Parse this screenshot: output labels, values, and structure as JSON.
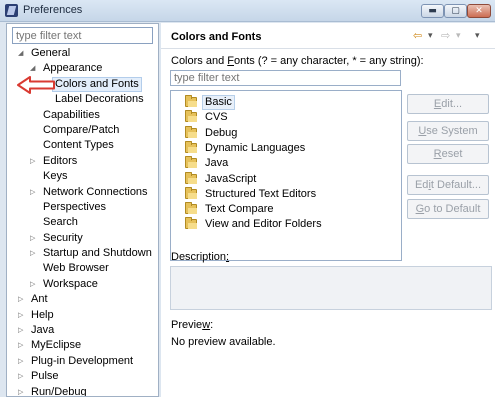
{
  "window": {
    "title": "Preferences",
    "controls": {
      "minimize": "▬",
      "maximize": "▢",
      "close": "✕"
    }
  },
  "left": {
    "filter_placeholder": "type filter text",
    "tree": [
      {
        "label": "General",
        "arrow": "◢",
        "level": 0,
        "expanded": true
      },
      {
        "label": "Appearance",
        "arrow": "◢",
        "level": 1,
        "expanded": true
      },
      {
        "label": "Colors and Fonts",
        "arrow": "",
        "level": 2,
        "selected": true
      },
      {
        "label": "Label Decorations",
        "arrow": "",
        "level": 2
      },
      {
        "label": "Capabilities",
        "arrow": "",
        "level": 1
      },
      {
        "label": "Compare/Patch",
        "arrow": "",
        "level": 1
      },
      {
        "label": "Content Types",
        "arrow": "",
        "level": 1
      },
      {
        "label": "Editors",
        "arrow": "▷",
        "level": 1
      },
      {
        "label": "Keys",
        "arrow": "",
        "level": 1
      },
      {
        "label": "Network Connections",
        "arrow": "▷",
        "level": 1
      },
      {
        "label": "Perspectives",
        "arrow": "",
        "level": 1
      },
      {
        "label": "Search",
        "arrow": "",
        "level": 1
      },
      {
        "label": "Security",
        "arrow": "▷",
        "level": 1
      },
      {
        "label": "Startup and Shutdown",
        "arrow": "▷",
        "level": 1
      },
      {
        "label": "Web Browser",
        "arrow": "",
        "level": 1
      },
      {
        "label": "Workspace",
        "arrow": "▷",
        "level": 1
      },
      {
        "label": "Ant",
        "arrow": "▷",
        "level": 0
      },
      {
        "label": "Help",
        "arrow": "▷",
        "level": 0
      },
      {
        "label": "Java",
        "arrow": "▷",
        "level": 0
      },
      {
        "label": "MyEclipse",
        "arrow": "▷",
        "level": 0
      },
      {
        "label": "Plug-in Development",
        "arrow": "▷",
        "level": 0
      },
      {
        "label": "Pulse",
        "arrow": "▷",
        "level": 0
      },
      {
        "label": "Run/Debug",
        "arrow": "▷",
        "level": 0
      }
    ]
  },
  "right": {
    "title": "Colors and Fonts",
    "nav": {
      "back": "⇦",
      "back_menu": "▾",
      "forward": "⇨",
      "forward_menu": "▾",
      "menu": "▾"
    },
    "colors_fonts_label_pre": "Colors and ",
    "colors_fonts_label_mnemonic": "F",
    "colors_fonts_label_post": "onts (? = any character, * = any string):",
    "font_filter_placeholder": "type filter text",
    "font_categories": [
      {
        "label": "Basic",
        "selected": true
      },
      {
        "label": "CVS"
      },
      {
        "label": "Debug"
      },
      {
        "label": "Dynamic Languages"
      },
      {
        "label": "Java"
      },
      {
        "label": "JavaScript"
      },
      {
        "label": "Structured Text Editors"
      },
      {
        "label": "Text Compare"
      },
      {
        "label": "View and Editor Folders"
      }
    ],
    "buttons": [
      {
        "pre": "",
        "mnemonic": "E",
        "post": "dit...",
        "enabled": false
      },
      {
        "pre": "",
        "mnemonic": "U",
        "post": "se System Font",
        "enabled": false
      },
      {
        "pre": "",
        "mnemonic": "R",
        "post": "eset",
        "enabled": false
      },
      {
        "pre": "Ed",
        "mnemonic": "i",
        "post": "t Default...",
        "enabled": false
      },
      {
        "pre": "",
        "mnemonic": "G",
        "post": "o to Default",
        "enabled": false
      }
    ],
    "description_pre": "Description",
    "description_mnemonic": ":",
    "preview_pre": "Previe",
    "preview_mnemonic": "w",
    "preview_post": ":",
    "preview_text": "No preview available."
  },
  "colors": {
    "selection_bg": "#e3eefb",
    "annotation_arrow": "#d93a32"
  }
}
